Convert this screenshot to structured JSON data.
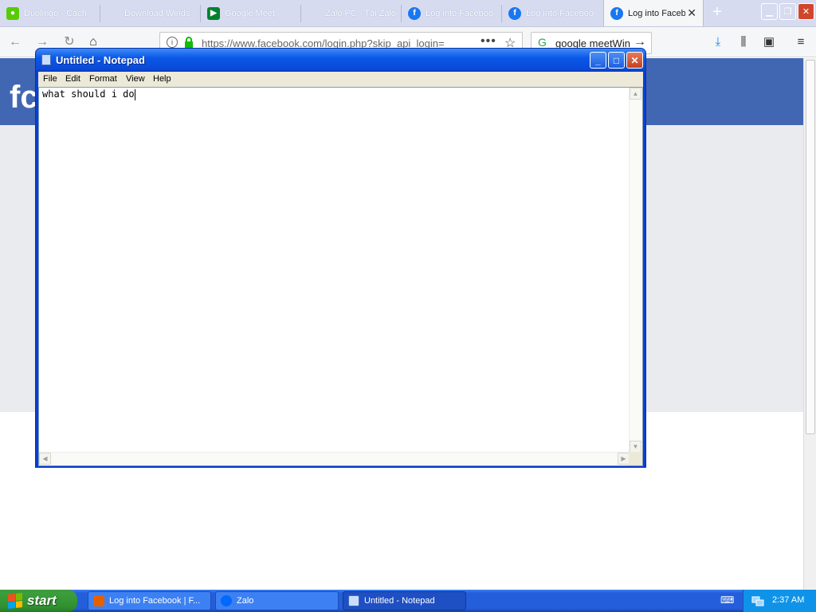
{
  "browser": {
    "tabs": [
      {
        "label": "Duolingo - Cách",
        "icon": "duolingo-icon",
        "color": "#58cc02"
      },
      {
        "label": "Download Winds",
        "icon": "windows-icon",
        "color": "#f25022"
      },
      {
        "label": "Google Meet",
        "icon": "google-meet-icon",
        "color": "#00832d"
      },
      {
        "label": "Zalo PC - Tải Zalo",
        "icon": "zalo-icon",
        "color": "#0068ff"
      },
      {
        "label": "Log into Faceboo",
        "icon": "facebook-icon",
        "color": "#1877f2"
      },
      {
        "label": "Log into Faceboo",
        "icon": "facebook-icon",
        "color": "#1877f2"
      },
      {
        "label": "Log into Faceb",
        "icon": "facebook-icon",
        "color": "#1877f2"
      }
    ],
    "url": "https://www.facebook.com/login.php?skip_api_login=",
    "search_query": "google meetWin"
  },
  "facebook": {
    "logo": "fc",
    "brand_color": "#4267b2"
  },
  "notepad": {
    "title": "Untitled - Notepad",
    "menu": [
      "File",
      "Edit",
      "Format",
      "View",
      "Help"
    ],
    "content": "what should i do"
  },
  "taskbar": {
    "start_label": "start",
    "items": [
      {
        "label": "Log into Facebook | F...",
        "icon": "firefox-icon"
      },
      {
        "label": "Zalo",
        "icon": "zalo-icon"
      },
      {
        "label": "Untitled - Notepad",
        "icon": "notepad-icon"
      }
    ],
    "clock": "2:37 AM"
  }
}
